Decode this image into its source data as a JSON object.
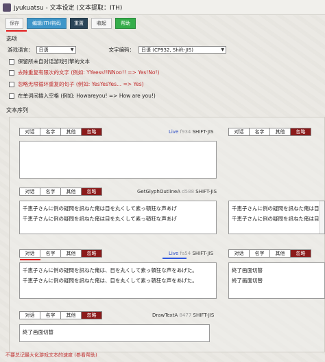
{
  "window": {
    "title": "jyukuatsu - 文本设定 (文本提取：ITH)"
  },
  "toolbar": {
    "save": "保存",
    "edit": "编辑/ITH钩码",
    "reset": "重置",
    "fold": "收起",
    "help": "帮助"
  },
  "options": {
    "title": "选项",
    "game_lang_label": "游戏语言：",
    "game_lang_value": "日语",
    "encoding_label": "文字编码：",
    "encoding_value": "日语 (CP932, Shift-JIS)",
    "checks": [
      "保留所未自对话游戏引擎的文本",
      "去除重复有限次的文字 (例如: YYeess!!NNoo!! => Yes!No!)",
      "忽略无限循环重复的句子 (例如: YesYesYes... => Yes)",
      "在单词间插入空格 (例如: Howareyou! => How are you!)"
    ]
  },
  "sequence": {
    "title": "文本序列",
    "tab_labels": [
      "对话",
      "名字",
      "其他",
      "忽略"
    ],
    "blocks": [
      {
        "live": "Live",
        "addr": "f934",
        "name": "",
        "enc": "SHIFT-JIS",
        "lines": []
      },
      {
        "live": "",
        "addr": "",
        "name": "",
        "enc": "SHIFT-JIS",
        "lines": []
      },
      {
        "live": "",
        "addr": "d588",
        "name": "GetGlyphOutlineA",
        "enc": "SHIFT-JIS",
        "lines": [
          "千恵子さんに例の疑問を訊ねた俺は目を丸くして素っ頓狂な声あげ",
          "千恵子さんに例の疑問を訊ねた俺は目を丸くして素っ頓狂な声あげ"
        ]
      },
      {
        "live": "",
        "addr": "",
        "name": "",
        "enc": "SHIFT-JIS",
        "lines": [
          "千恵子さんに例の疑問を訊ねた俺は目を丸くして素っ頓狂な声あげ",
          "千恵子さんに例の疑問を訊ねた俺は目を丸くして素っ頓狂な声あげ"
        ]
      },
      {
        "live": "Live",
        "addr": "fa54",
        "name": "",
        "enc": "SHIFT-JIS",
        "lines": [
          "千恵子さんに例の疑問を訊ねた俺は、目を丸くして素っ頓狂な声をあげた。",
          "千恵子さんに例の疑問を訊ねた俺は、目を丸くして素っ頓狂な声をあげた。"
        ]
      },
      {
        "live": "",
        "addr": "",
        "name": "",
        "enc": "SHIFT-JIS",
        "lines": [
          "終了画面切替",
          "終了画面切替"
        ]
      },
      {
        "live": "",
        "addr": "8477",
        "name": "DrawTextA",
        "enc": "SHIFT-JIS",
        "lines": [
          "終了画面切替"
        ]
      }
    ]
  },
  "footer": "不要总记最大化游戏文本的速度 (参看帮助)",
  "colors": {
    "active_tab": "#8b1a1a",
    "accent_red": "#e31a1a",
    "accent_blue": "#2d56e0"
  }
}
